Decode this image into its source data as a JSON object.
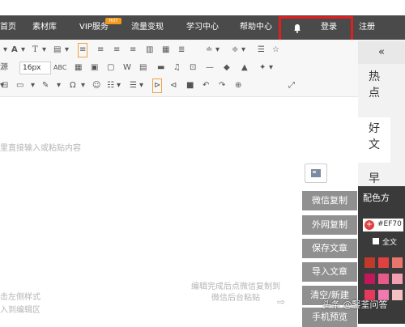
{
  "nav": {
    "items": [
      "首页",
      "素材库",
      "VIP服务",
      "流量变现",
      "学习中心",
      "帮助中心",
      "登录",
      "注册"
    ],
    "hot_badge": "HOT"
  },
  "toolbar": {
    "font_size": "16px",
    "abc_label": "ABC"
  },
  "editor": {
    "placeholder": "里直接输入或粘贴内容",
    "left_hint_1": "击左侧样式",
    "left_hint_2": "入到编辑区",
    "right_hint": "编辑完成后点微信复制到微信后台粘贴"
  },
  "side_actions": [
    "微信复制",
    "外网复制",
    "保存文章",
    "导入文章",
    "清空/新建",
    "手机预览"
  ],
  "right_rail": {
    "collapse": "«",
    "label_1": "热点",
    "label_2": "好文",
    "label_3": "早"
  },
  "color_panel": {
    "title": "配色方",
    "hex_value": "#EF70",
    "checkbox_label": "全文",
    "colors": [
      "#c0392b",
      "#e04040",
      "#e8766a",
      "#c2185b",
      "#e85a8a",
      "#f0a0b0",
      "#e63a5c",
      "#f07ab0",
      "#f4c2c2"
    ]
  },
  "watermark": "头条 @鋻荃问答"
}
